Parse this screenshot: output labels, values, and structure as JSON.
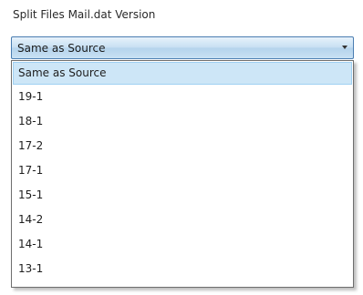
{
  "panel": {
    "title": "Split Files Mail.dat Version"
  },
  "combo": {
    "value": "Same as Source",
    "icon": "chevron-down-icon"
  },
  "dropdown": {
    "selected_index": 0,
    "options": [
      "Same as Source",
      "19-1",
      "18-1",
      "17-2",
      "17-1",
      "15-1",
      "14-2",
      "14-1",
      "13-1"
    ]
  },
  "colors": {
    "combo_border": "#4a7db1",
    "selected_option_bg": "#cde6f7"
  }
}
